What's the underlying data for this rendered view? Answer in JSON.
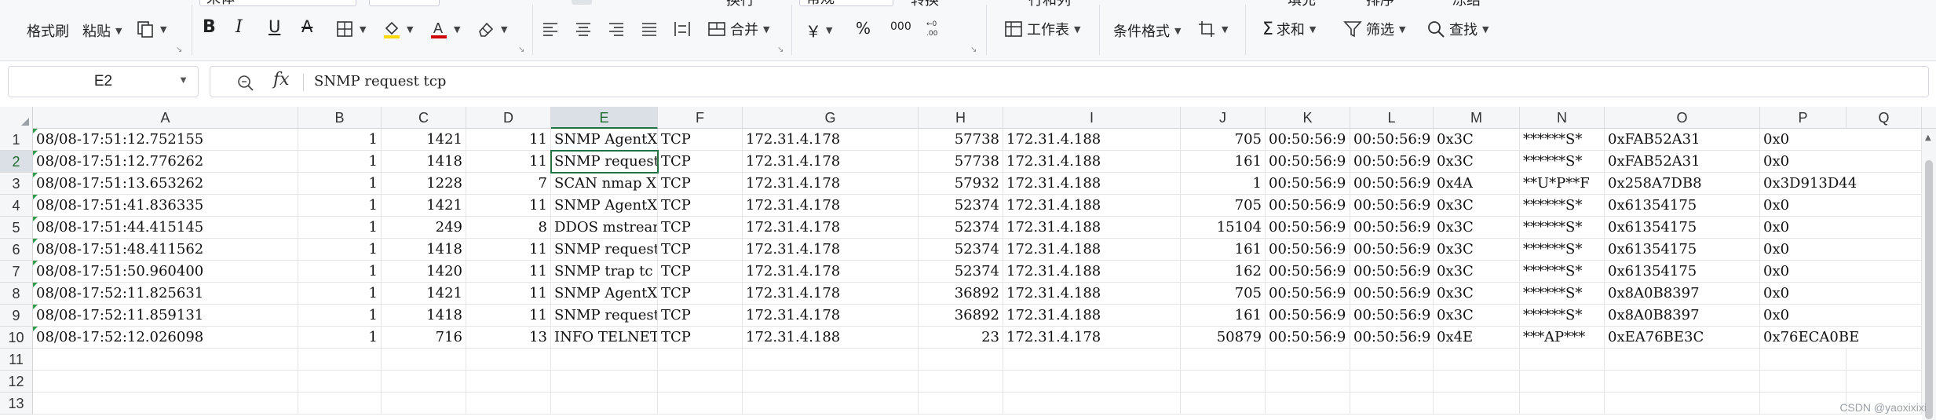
{
  "ribbon": {
    "format_painter": "格式刷",
    "paste": "粘贴",
    "font_name": "宋体",
    "bold": "B",
    "italic": "I",
    "underline": "U",
    "strike": "A",
    "merge": "合并",
    "number_format": "常规",
    "percent": "%",
    "currency": "￥",
    "thousands": "000",
    "worksheet": "工作表",
    "conditional_format": "条件格式",
    "sum": "求和",
    "filter": "筛选",
    "find": "查找",
    "wrap": "换行",
    "row_col": "行和列",
    "convert": "转换",
    "fill": "填充",
    "sort": "排序",
    "freeze": "冻结",
    "accent_color": "#217346",
    "font_color": "#d00000",
    "fill_color": "#ffd800"
  },
  "formula_bar": {
    "cell_ref": "E2",
    "fx": "fx",
    "content": "SNMP request tcp"
  },
  "columns": [
    "A",
    "B",
    "C",
    "D",
    "E",
    "F",
    "G",
    "H",
    "I",
    "J",
    "K",
    "L",
    "M",
    "N",
    "O",
    "P",
    "Q"
  ],
  "selected_column": "E",
  "selected_row": "2",
  "row_numbers": [
    "1",
    "2",
    "3",
    "4",
    "5",
    "6",
    "7",
    "8",
    "9",
    "10",
    "11",
    "12",
    "13"
  ],
  "rows": [
    [
      "08/08-17:51:12.752155",
      "1",
      "1421",
      "11",
      "SNMP AgentX/",
      "TCP",
      "172.31.4.178",
      "57738",
      "172.31.4.188",
      "705",
      "00:50:56:9",
      "00:50:56:9",
      "0x3C",
      "******S*",
      "0xFAB52A31",
      "0x0"
    ],
    [
      "08/08-17:51:12.776262",
      "1",
      "1418",
      "11",
      "SNMP request",
      "TCP",
      "172.31.4.178",
      "57738",
      "172.31.4.188",
      "161",
      "00:50:56:9",
      "00:50:56:9",
      "0x3C",
      "******S*",
      "0xFAB52A31",
      "0x0"
    ],
    [
      "08/08-17:51:13.653262",
      "1",
      "1228",
      "7",
      "SCAN nmap XM",
      "TCP",
      "172.31.4.178",
      "57932",
      "172.31.4.188",
      "1",
      "00:50:56:9",
      "00:50:56:9",
      "0x4A",
      "**U*P**F",
      "0x258A7DB8",
      "0x3D913D44"
    ],
    [
      "08/08-17:51:41.836335",
      "1",
      "1421",
      "11",
      "SNMP AgentX/",
      "TCP",
      "172.31.4.178",
      "52374",
      "172.31.4.188",
      "705",
      "00:50:56:9",
      "00:50:56:9",
      "0x3C",
      "******S*",
      "0x61354175",
      "0x0"
    ],
    [
      "08/08-17:51:44.415145",
      "1",
      "249",
      "8",
      "DDOS mstream",
      "TCP",
      "172.31.4.178",
      "52374",
      "172.31.4.188",
      "15104",
      "00:50:56:9",
      "00:50:56:9",
      "0x3C",
      "******S*",
      "0x61354175",
      "0x0"
    ],
    [
      "08/08-17:51:48.411562",
      "1",
      "1418",
      "11",
      "SNMP request",
      "TCP",
      "172.31.4.178",
      "52374",
      "172.31.4.188",
      "161",
      "00:50:56:9",
      "00:50:56:9",
      "0x3C",
      "******S*",
      "0x61354175",
      "0x0"
    ],
    [
      "08/08-17:51:50.960400",
      "1",
      "1420",
      "11",
      "SNMP trap tc",
      "TCP",
      "172.31.4.178",
      "52374",
      "172.31.4.188",
      "162",
      "00:50:56:9",
      "00:50:56:9",
      "0x3C",
      "******S*",
      "0x61354175",
      "0x0"
    ],
    [
      "08/08-17:52:11.825631",
      "1",
      "1421",
      "11",
      "SNMP AgentX/",
      "TCP",
      "172.31.4.178",
      "36892",
      "172.31.4.188",
      "705",
      "00:50:56:9",
      "00:50:56:9",
      "0x3C",
      "******S*",
      "0x8A0B8397",
      "0x0"
    ],
    [
      "08/08-17:52:11.859131",
      "1",
      "1418",
      "11",
      "SNMP request",
      "TCP",
      "172.31.4.178",
      "36892",
      "172.31.4.188",
      "161",
      "00:50:56:9",
      "00:50:56:9",
      "0x3C",
      "******S*",
      "0x8A0B8397",
      "0x0"
    ],
    [
      "08/08-17:52:12.026098",
      "1",
      "716",
      "13",
      "INFO TELNET",
      "TCP",
      "172.31.4.188",
      "23",
      "172.31.4.178",
      "50879",
      "00:50:56:9",
      "00:50:56:9",
      "0x4E",
      "***AP***",
      "0xEA76BE3C",
      "0x76ECA0BE"
    ]
  ],
  "watermark": "CSDN @yaoxixixi"
}
